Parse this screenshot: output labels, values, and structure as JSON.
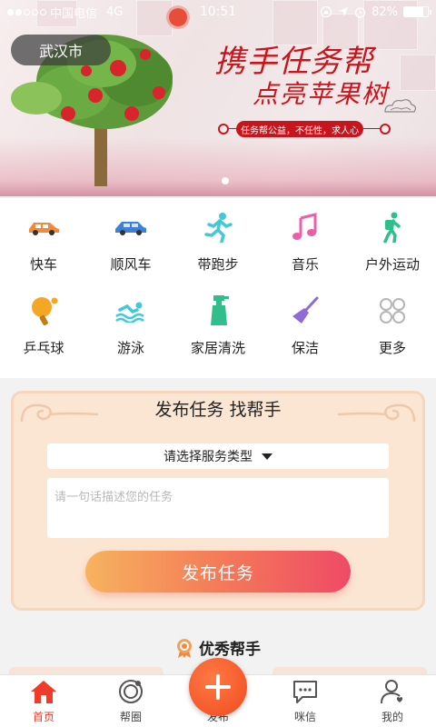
{
  "status_bar": {
    "carrier": "中国电信",
    "network": "4G",
    "time": "10:51",
    "battery_text": "82%",
    "battery_level": 0.82,
    "signal_bars_filled": 2,
    "signal_bars_total": 5
  },
  "banner": {
    "city": "武汉市",
    "slogan_line1": "携手任务帮",
    "slogan_line2": "点亮苹果树",
    "tagline": "任务帮公益，不任性，求人心",
    "page_count": 4,
    "current_page": 2
  },
  "categories": [
    {
      "label": "快车",
      "icon": "car-icon",
      "color": "#f08a3c"
    },
    {
      "label": "顺风车",
      "icon": "sedan-icon",
      "color": "#3f7fd6"
    },
    {
      "label": "带跑步",
      "icon": "runner-icon",
      "color": "#42c9d8"
    },
    {
      "label": "音乐",
      "icon": "music-note-icon",
      "color": "#ec5fa8"
    },
    {
      "label": "户外运动",
      "icon": "hiker-icon",
      "color": "#2fbf8a"
    },
    {
      "label": "乒乓球",
      "icon": "ping-pong-icon",
      "color": "#f5a623"
    },
    {
      "label": "游泳",
      "icon": "swimmer-icon",
      "color": "#42c9d8"
    },
    {
      "label": "家居清洗",
      "icon": "spray-bottle-icon",
      "color": "#2fbf8a"
    },
    {
      "label": "保洁",
      "icon": "broom-icon",
      "color": "#8e6bd6"
    },
    {
      "label": "更多",
      "icon": "grid-more-icon",
      "color": "#b5b5b5"
    }
  ],
  "publish": {
    "title": "发布任务 找帮手",
    "service_select": "请选择服务类型",
    "description_placeholder": "请一句话描述您的任务",
    "button": "发布任务"
  },
  "helpers": {
    "title": "优秀帮手"
  },
  "tabs": [
    {
      "label": "首页",
      "icon": "home-icon",
      "active": true
    },
    {
      "label": "帮圈",
      "icon": "circle-icon",
      "active": false
    },
    {
      "label": "发布",
      "icon": "plus-icon",
      "active": false
    },
    {
      "label": "咪信",
      "icon": "chat-icon",
      "active": false
    },
    {
      "label": "我的",
      "icon": "user-icon",
      "active": false
    }
  ],
  "colors": {
    "accent": "#ef3b2a",
    "button_gradient_start": "#f7b35f",
    "button_gradient_end": "#ef4a66",
    "card_bg": "#fbe6d4"
  }
}
